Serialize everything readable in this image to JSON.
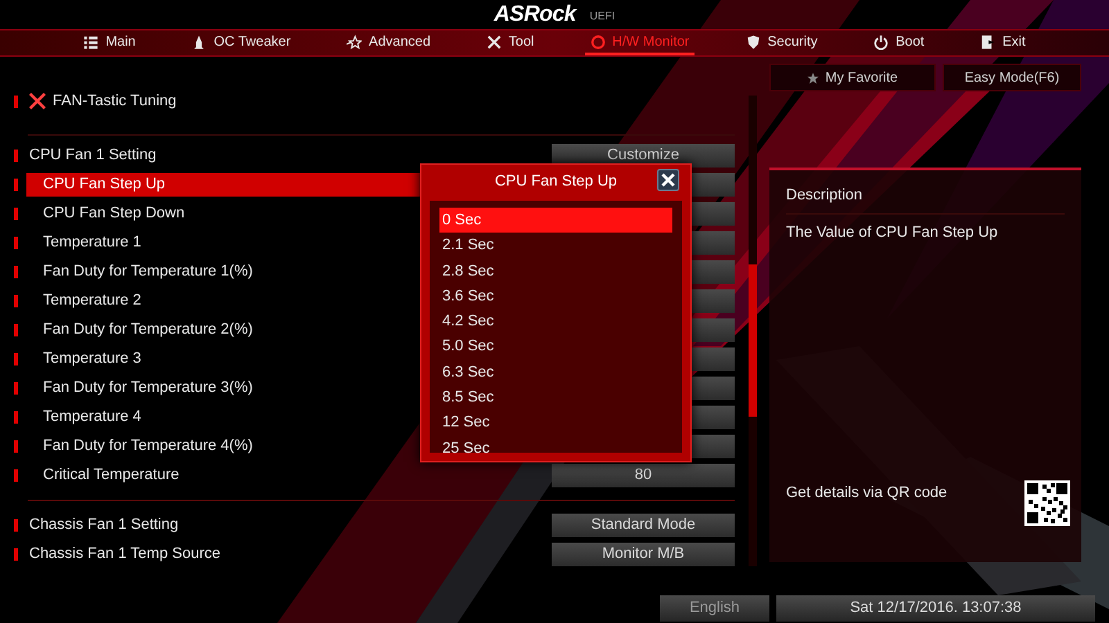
{
  "brand": "ASRock",
  "brand_suffix": "UEFI",
  "nav_tabs": [
    {
      "label": "Main",
      "kind": "main",
      "selected": false
    },
    {
      "label": "OC Tweaker",
      "kind": "tweaker",
      "selected": false
    },
    {
      "label": "Advanced",
      "kind": "advanced",
      "selected": false
    },
    {
      "label": "Tool",
      "kind": "tool",
      "selected": false
    },
    {
      "label": "H/W Monitor",
      "kind": "monitor",
      "selected": true
    },
    {
      "label": "Security",
      "kind": "security",
      "selected": false
    },
    {
      "label": "Boot",
      "kind": "boot",
      "selected": false
    },
    {
      "label": "Exit",
      "kind": "exit",
      "selected": false
    }
  ],
  "favorite_button": "My Favorite",
  "easy_mode_button": "Easy Mode(F6)",
  "section_title": "FAN-Tastic Tuning",
  "settings": [
    {
      "label": "CPU Fan 1 Setting",
      "kind": "group",
      "selected": false,
      "value": "Customize"
    },
    {
      "label": "CPU Fan Step Up",
      "kind": "item",
      "selected": true
    },
    {
      "label": "CPU Fan Step Down",
      "kind": "item",
      "selected": false
    },
    {
      "label": "Temperature 1",
      "kind": "item",
      "selected": false
    },
    {
      "label": "Fan Duty for Temperature 1(%)",
      "kind": "item",
      "selected": false
    },
    {
      "label": "Temperature 2",
      "kind": "item",
      "selected": false
    },
    {
      "label": "Fan Duty for Temperature 2(%)",
      "kind": "item",
      "selected": false
    },
    {
      "label": "Temperature 3",
      "kind": "item",
      "selected": false
    },
    {
      "label": "Fan Duty for Temperature 3(%)",
      "kind": "item",
      "selected": false
    },
    {
      "label": "Temperature 4",
      "kind": "item",
      "selected": false
    },
    {
      "label": "Fan Duty for Temperature 4(%)",
      "kind": "item",
      "selected": false
    },
    {
      "label": "Critical Temperature",
      "kind": "item",
      "selected": false,
      "value": "80"
    },
    {
      "label": "Chassis Fan 1 Setting",
      "kind": "group",
      "selected": false,
      "value": "Standard Mode",
      "divider_before": true
    },
    {
      "label": "Chassis Fan 1 Temp Source",
      "kind": "group",
      "selected": false,
      "value": "Monitor M/B"
    }
  ],
  "popup": {
    "title": "CPU Fan Step Up",
    "options": [
      {
        "label": "0 Sec",
        "selected": true
      },
      {
        "label": "2.1 Sec",
        "selected": false
      },
      {
        "label": "2.8 Sec",
        "selected": false
      },
      {
        "label": "3.6 Sec",
        "selected": false
      },
      {
        "label": "4.2 Sec",
        "selected": false
      },
      {
        "label": "5.0 Sec",
        "selected": false
      },
      {
        "label": "6.3 Sec",
        "selected": false
      },
      {
        "label": "8.5 Sec",
        "selected": false
      },
      {
        "label": "12 Sec",
        "selected": false
      },
      {
        "label": "25 Sec",
        "selected": false
      }
    ]
  },
  "description": {
    "heading": "Description",
    "text": "The Value of CPU Fan Step Up",
    "qr_hint": "Get details via QR code"
  },
  "status_bar": {
    "language": "English",
    "datetime": "Sat 12/17/2016. 13:07:38"
  }
}
